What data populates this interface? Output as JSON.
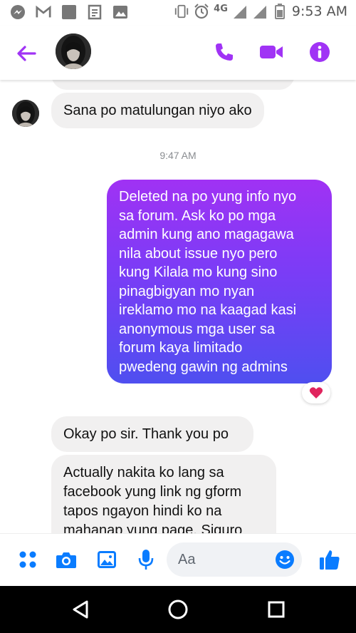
{
  "status_bar": {
    "network": "4G",
    "time": "9:53 AM"
  },
  "colors": {
    "accent": "#a033f5",
    "messenger_blue": "#0a7cff",
    "outgoing_top": "#a032f4",
    "outgoing_bottom": "#4f4ff0",
    "heart": "#e0245e"
  },
  "messages": [
    {
      "direction": "incoming",
      "text": "Sana po matulungan niyo ako"
    },
    {
      "type": "timestamp",
      "text": "9:47 AM"
    },
    {
      "direction": "outgoing",
      "lines": [
        "Deleted na po yung info nyo",
        "sa forum. Ask ko po mga",
        "admin kung ano magagawa",
        "nila about issue nyo pero",
        "kung Kilala mo kung sino",
        "pinagbigyan mo nyan",
        "ireklamo mo na kaagad kasi",
        "anonymous mga user sa",
        "forum kaya limitado",
        "pwedeng gawin ng admins"
      ],
      "reaction": "heart"
    },
    {
      "direction": "incoming",
      "text": "Okay po sir. Thank you po"
    },
    {
      "direction": "incoming",
      "lines": [
        "Actually nakita ko lang sa",
        "facebook yung link ng gform",
        "tapos ngayon hindi ko na",
        "mahanap yung page. Siguro"
      ]
    }
  ],
  "composer": {
    "placeholder": "Aa"
  }
}
